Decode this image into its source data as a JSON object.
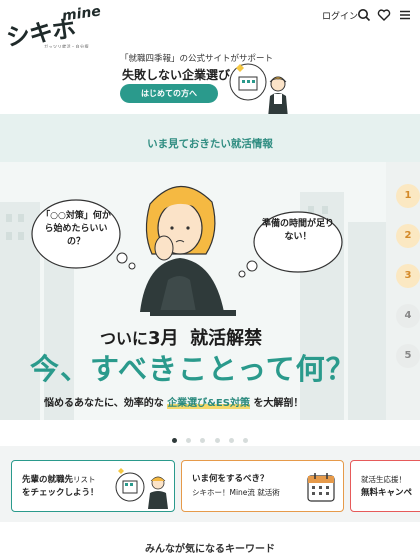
{
  "header": {
    "logo_text": "シキホー!",
    "logo_sub": "mine",
    "logo_tagline": "ガッツリ就活・自分探しまで",
    "login_label": "ログイン",
    "icons": [
      "search-icon",
      "heart-icon",
      "menu-icon"
    ]
  },
  "promo": {
    "small_text": "「就職四季報」の公式サイトがサポート",
    "title": "失敗しない企業選び",
    "button_label": "はじめての方へ"
  },
  "section": {
    "title": "いま見ておきたい就活情報"
  },
  "hero": {
    "bubble_left": "「○○対策」何から始めたらいいの？",
    "bubble_right": "準備の時間が足りない！",
    "line1_a": "ついに",
    "line1_b": "3月",
    "line1_c": "就活解禁",
    "line2": "今、すべきことって何？",
    "line3_a": "悩めるあなたに、効率的な",
    "line3_highlight": "企業選び&ES対策",
    "line3_b": "を大解剖！"
  },
  "rank_tabs": [
    "1",
    "2",
    "3",
    "4",
    "5"
  ],
  "carousel": {
    "slide_count": 6,
    "active_index": 0
  },
  "cards": [
    {
      "line1": "先輩の就職先",
      "line1_small": "リスト",
      "line2": "をチェックしよう！"
    },
    {
      "line1": "いま何をするべき？",
      "line2": "シキホー！Mine流 就活術"
    },
    {
      "line1": "就活生応援！",
      "line2": "無料キャンペ"
    }
  ],
  "keywords": {
    "title": "みんなが気になるキーワード"
  },
  "colors": {
    "accent": "#2a9a8c",
    "band": "#e6f1ef",
    "highlight": "#f5d96b",
    "orange": "#e69a4a",
    "red": "#e65a5a"
  }
}
